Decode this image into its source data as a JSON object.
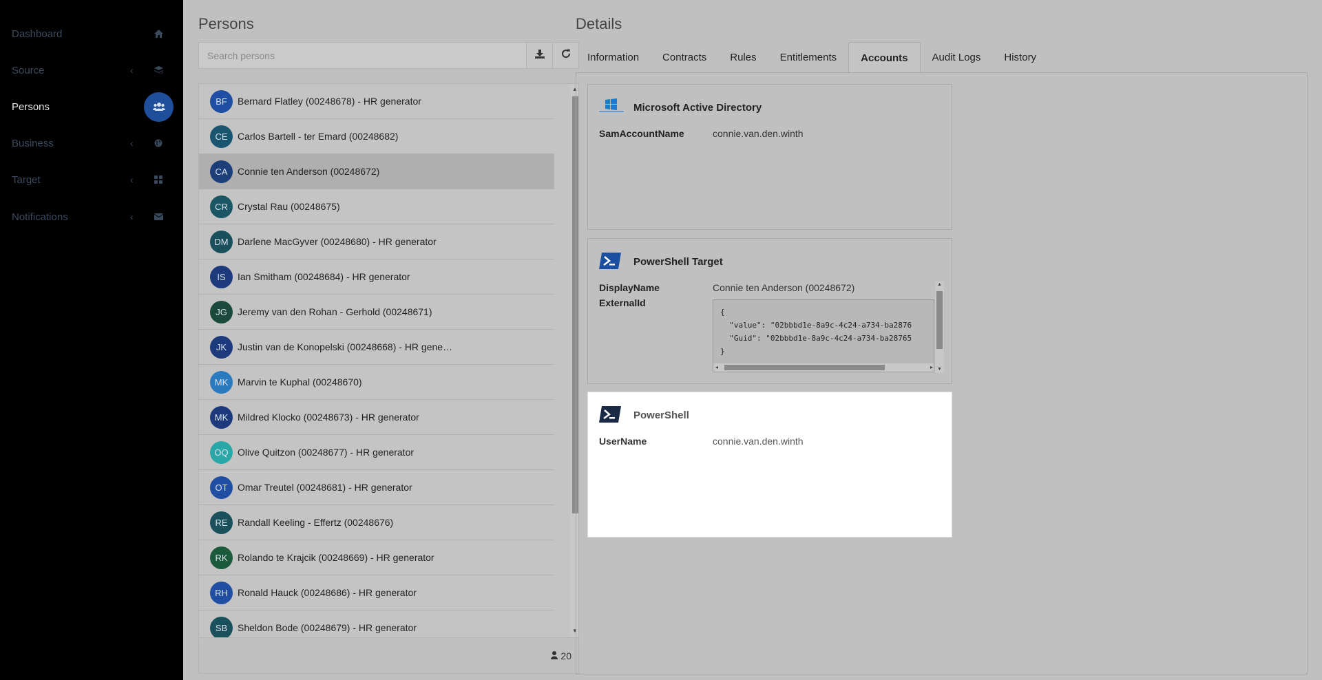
{
  "sidebar": {
    "items": [
      {
        "label": "Dashboard",
        "icon": "home-icon",
        "has_chevron": false
      },
      {
        "label": "Source",
        "icon": "layers-icon",
        "has_chevron": true
      },
      {
        "label": "Persons",
        "icon": "users-icon",
        "has_chevron": false,
        "active": true
      },
      {
        "label": "Business",
        "icon": "globe-icon",
        "has_chevron": true
      },
      {
        "label": "Target",
        "icon": "grid-icon",
        "has_chevron": true
      },
      {
        "label": "Notifications",
        "icon": "envelope-icon",
        "has_chevron": true
      }
    ],
    "chevron": "‹"
  },
  "persons": {
    "title": "Persons",
    "search_placeholder": "Search persons",
    "count": "20",
    "rows": [
      {
        "initials": "BF",
        "name": "Bernard Flatley (00248678) - HR generator",
        "color": "#1f4ea3"
      },
      {
        "initials": "CE",
        "name": "Carlos Bartell - ter Emard (00248682)",
        "color": "#1a5670"
      },
      {
        "initials": "CA",
        "name": "Connie ten Anderson (00248672)",
        "color": "#1c3f7a"
      },
      {
        "initials": "CR",
        "name": "Crystal Rau (00248675)",
        "color": "#1a5663"
      },
      {
        "initials": "DM",
        "name": "Darlene MacGyver (00248680) - HR generator",
        "color": "#1a4f5c"
      },
      {
        "initials": "IS",
        "name": "Ian Smitham (00248684) - HR generator",
        "color": "#1c3a7c"
      },
      {
        "initials": "JG",
        "name": "Jeremy van den Rohan - Gerhold (00248671)",
        "color": "#1b4a3c"
      },
      {
        "initials": "JK",
        "name": "Justin van de Konopelski (00248668) - HR gene…",
        "color": "#1c3a7c"
      },
      {
        "initials": "MK",
        "name": "Marvin te Kuphal (00248670)",
        "color": "#2a7ac0"
      },
      {
        "initials": "MK",
        "name": "Mildred Klocko (00248673) - HR generator",
        "color": "#1c3a7c"
      },
      {
        "initials": "OQ",
        "name": "Olive Quitzon (00248677) - HR generator",
        "color": "#2aa8a8"
      },
      {
        "initials": "OT",
        "name": "Omar Treutel (00248681) - HR generator",
        "color": "#1f4ea3"
      },
      {
        "initials": "RE",
        "name": "Randall Keeling - Effertz (00248676)",
        "color": "#1a4f5c"
      },
      {
        "initials": "RK",
        "name": "Rolando te Krajcik (00248669) - HR generator",
        "color": "#1b5a3a"
      },
      {
        "initials": "RH",
        "name": "Ronald Hauck (00248686) - HR generator",
        "color": "#1f4ea3"
      },
      {
        "initials": "SB",
        "name": "Sheldon Bode (00248679) - HR generator",
        "color": "#1a4f5c"
      }
    ],
    "selected_index": 2
  },
  "details": {
    "title": "Details",
    "tabs": [
      "Information",
      "Contracts",
      "Rules",
      "Entitlements",
      "Accounts",
      "Audit Logs",
      "History"
    ],
    "active_tab": "Accounts",
    "cards": {
      "ad": {
        "title": "Microsoft Active Directory",
        "label": "SamAccountName",
        "value": "connie.van.den.winth"
      },
      "ps_target": {
        "title": "PowerShell Target",
        "display_label": "DisplayName",
        "display_value": "Connie ten Anderson (00248672)",
        "external_label": "ExternalId",
        "code": "{\n  \"value\": \"02bbbd1e-8a9c-4c24-a734-ba2876\n  \"Guid\": \"02bbbd1e-8a9c-4c24-a734-ba28765\n}"
      },
      "ps": {
        "title": "PowerShell",
        "label": "UserName",
        "value": "connie.van.den.winth"
      }
    }
  }
}
